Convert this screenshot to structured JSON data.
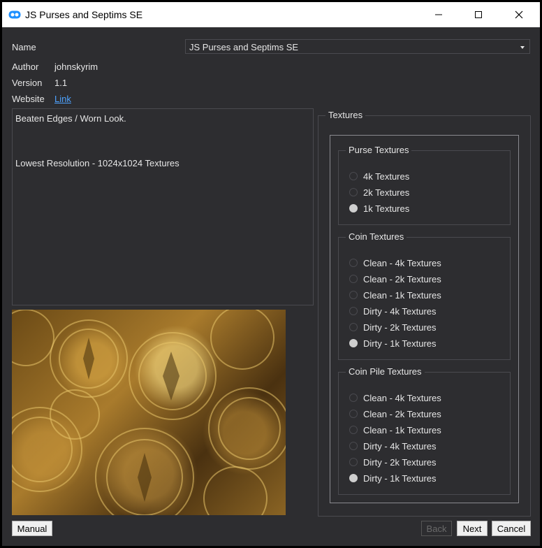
{
  "window": {
    "title": "JS Purses and Septims SE"
  },
  "meta": {
    "name_label": "Name",
    "name_value": "JS Purses and Septims SE",
    "author_label": "Author",
    "author_value": "johnskyrim",
    "version_label": "Version",
    "version_value": "1.1",
    "website_label": "Website",
    "website_link": "Link"
  },
  "description": {
    "line1": "Beaten Edges / Worn Look.",
    "line2": "Lowest Resolution - 1024x1024 Textures"
  },
  "image": {
    "alt": "coin-pile-image"
  },
  "textures": {
    "label": "Textures",
    "purse": {
      "label": "Purse Textures",
      "options": [
        "4k Textures",
        "2k Textures",
        "1k Textures"
      ],
      "selected": "1k Textures"
    },
    "coin": {
      "label": "Coin Textures",
      "options": [
        "Clean - 4k Textures",
        "Clean - 2k Textures",
        "Clean - 1k Textures",
        "Dirty - 4k Textures",
        "Dirty - 2k Textures",
        "Dirty - 1k Textures"
      ],
      "selected": "Dirty - 1k Textures"
    },
    "pile": {
      "label": "Coin Pile Textures",
      "options": [
        "Clean - 4k Textures",
        "Clean - 2k Textures",
        "Clean - 1k Textures",
        "Dirty - 4k Textures",
        "Dirty - 2k Textures",
        "Dirty - 1k Textures"
      ],
      "selected": "Dirty - 1k Textures"
    }
  },
  "buttons": {
    "manual": "Manual",
    "back": "Back",
    "next": "Next",
    "cancel": "Cancel"
  },
  "colors": {
    "background": "#2d2d30",
    "link": "#4ea3ff",
    "border": "#4a4a4f"
  }
}
